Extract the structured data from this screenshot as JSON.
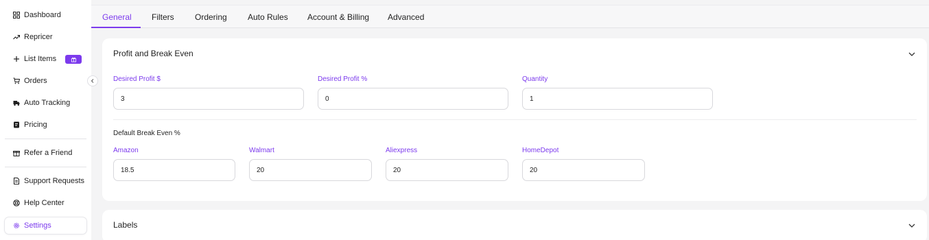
{
  "sidebar": {
    "items": [
      {
        "label": "Dashboard",
        "icon": "grid-icon"
      },
      {
        "label": "Repricer",
        "icon": "trend-up-icon"
      },
      {
        "label": "List Items",
        "icon": "plus-icon"
      },
      {
        "label": "Orders",
        "icon": "cart-icon"
      },
      {
        "label": "Auto Tracking",
        "icon": "truck-icon"
      },
      {
        "label": "Pricing",
        "icon": "card-icon"
      },
      {
        "label": "Refer a Friend",
        "icon": "gift-icon"
      },
      {
        "label": "Support Requests",
        "icon": "document-icon"
      },
      {
        "label": "Help Center",
        "icon": "lifebuoy-icon"
      },
      {
        "label": "Settings",
        "icon": "gear-icon"
      }
    ],
    "active": "Settings",
    "accent": "#7c3aed"
  },
  "tabs": {
    "items": [
      "General",
      "Filters",
      "Ordering",
      "Auto Rules",
      "Account & Billing",
      "Advanced"
    ],
    "active": "General"
  },
  "profit_card": {
    "title": "Profit and Break Even",
    "desired_profit_dollar": {
      "label": "Desired Profit $",
      "value": "3"
    },
    "desired_profit_percent": {
      "label": "Desired Profit %",
      "value": "0"
    },
    "quantity": {
      "label": "Quantity",
      "value": "1"
    },
    "break_even_heading": "Default Break Even %",
    "amazon": {
      "label": "Amazon",
      "value": "18.5"
    },
    "walmart": {
      "label": "Walmart",
      "value": "20"
    },
    "aliexpress": {
      "label": "Aliexpress",
      "value": "20"
    },
    "homedepot": {
      "label": "HomeDepot",
      "value": "20"
    }
  },
  "labels_card": {
    "title": "Labels"
  }
}
